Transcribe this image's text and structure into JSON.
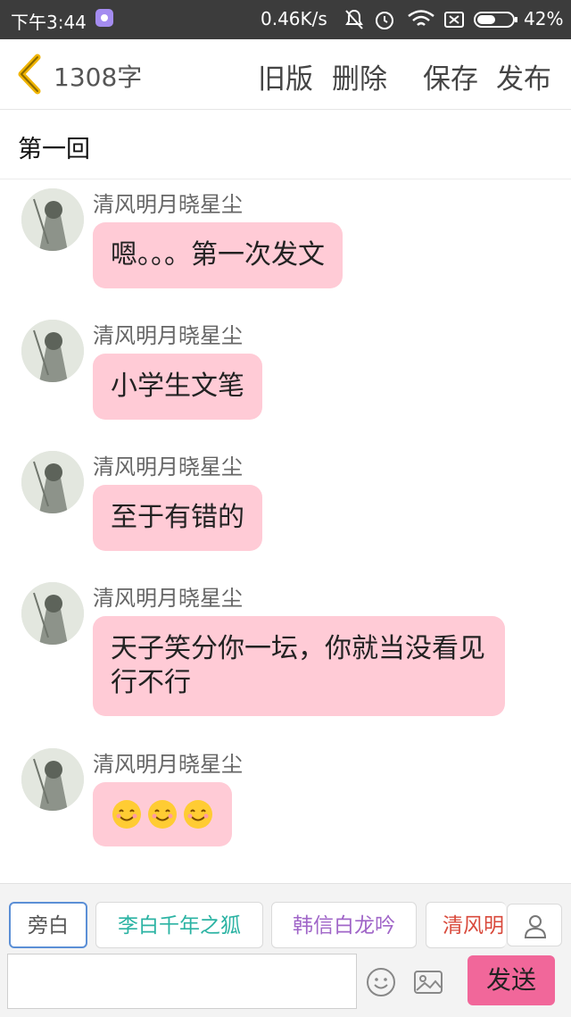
{
  "status_bar": {
    "time": "下午3:44",
    "net_speed": "0.46K/s",
    "battery": "42%"
  },
  "header": {
    "word_count": "1308字",
    "btn_old": "旧版",
    "btn_delete": "删除",
    "btn_save": "保存",
    "btn_publish": "发布"
  },
  "chapter": {
    "title": "第一回"
  },
  "messages": [
    {
      "sender": "清风明月晓星尘",
      "text": "嗯。。。第一次发文"
    },
    {
      "sender": "清风明月晓星尘",
      "text": "小学生文笔"
    },
    {
      "sender": "清风明月晓星尘",
      "text": "至于有错的"
    },
    {
      "sender": "清风明月晓星尘",
      "text": "天子笑分你一坛，你就当没看见行不行"
    },
    {
      "sender": "清风明月晓星尘",
      "emoji": [
        "smile-emoji",
        "smile-emoji",
        "smile-emoji"
      ]
    }
  ],
  "roles": [
    {
      "label": "旁白",
      "color": "#555555"
    },
    {
      "label": "李白千年之狐",
      "color": "#2bb3a3"
    },
    {
      "label": "韩信白龙吟",
      "color": "#a066c8"
    },
    {
      "label": "清风明",
      "color": "#d94a3c"
    }
  ],
  "input": {
    "value": "",
    "placeholder": ""
  },
  "send_label": "发送",
  "colors": {
    "bubble": "#ffcbd6",
    "send": "#f1679a",
    "back_arrow": "#f0b400"
  }
}
